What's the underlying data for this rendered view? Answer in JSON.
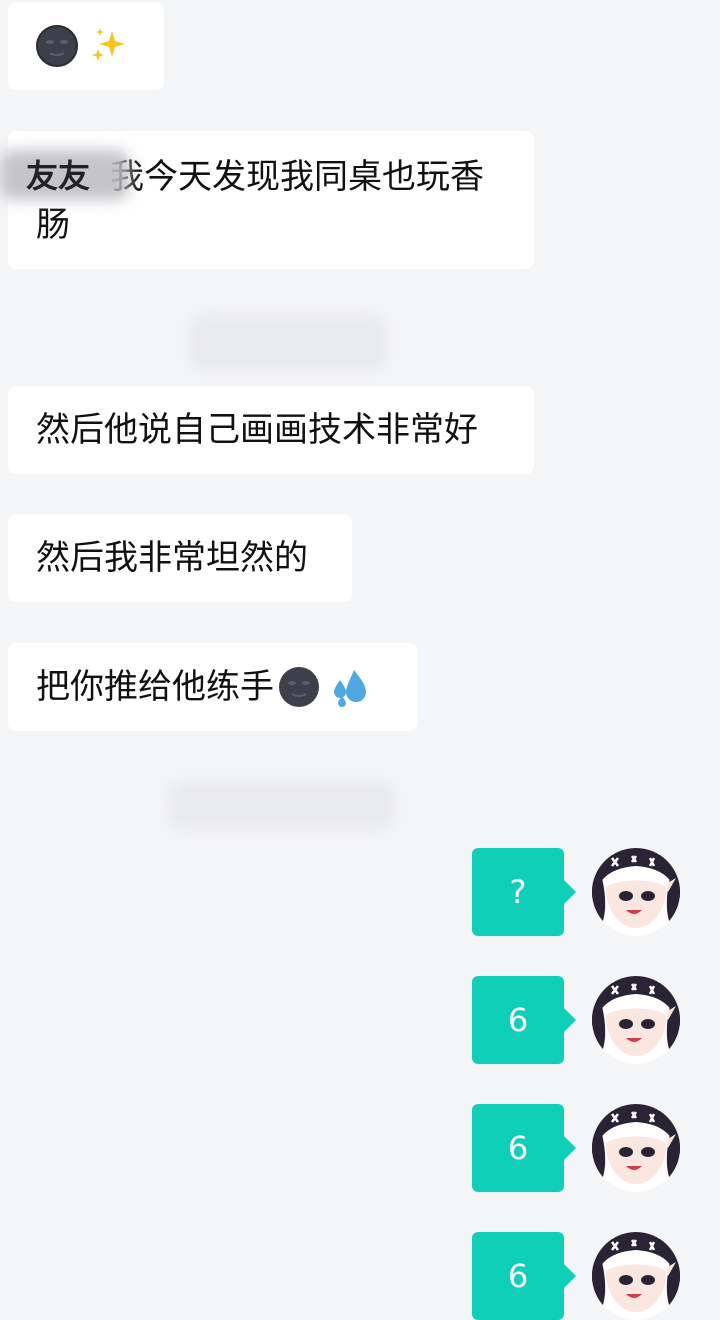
{
  "messages_in": [
    {
      "text": "",
      "emojis": [
        "new-moon-face-icon",
        "sparkles-icon"
      ]
    },
    {
      "sender": "友友",
      "line1": "我今天发现我同桌也玩香",
      "line2": "肠"
    },
    {
      "text": "然后他说自己画画技术非常好"
    },
    {
      "text": "然后我非常坦然的"
    },
    {
      "text": "把你推给他练手",
      "emojis": [
        "new-moon-face-icon",
        "sweat-droplets-icon"
      ]
    }
  ],
  "messages_out": [
    {
      "text": "?"
    },
    {
      "text": "6"
    },
    {
      "text": "6"
    },
    {
      "text": "6"
    }
  ],
  "colors": {
    "background": "#f4f5f7",
    "incoming_bubble": "#ffffff",
    "outgoing_bubble": "#0fcfb8"
  }
}
